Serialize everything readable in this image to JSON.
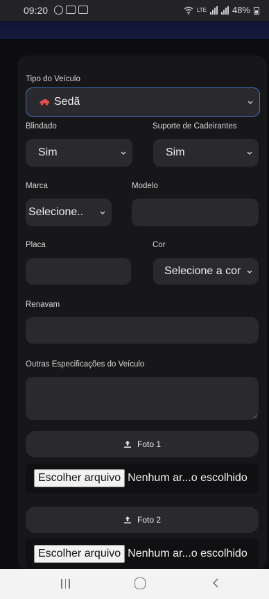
{
  "status_bar": {
    "time": "09:20",
    "network_text": "LTE",
    "battery": "48%"
  },
  "form": {
    "tipo_label": "Tipo do Veículo",
    "tipo_value": "Sedã",
    "blindado_label": "Blindado",
    "blindado_value": "Sim",
    "suporte_label": "Suporte de Cadeirantes",
    "suporte_value": "Sim",
    "marca_label": "Marca",
    "marca_value": "Selecione..",
    "modelo_label": "Modelo",
    "modelo_value": "",
    "placa_label": "Placa",
    "placa_value": "",
    "cor_label": "Cor",
    "cor_value": "Selecione a cor",
    "renavam_label": "Renavam",
    "renavam_value": "",
    "outras_label": "Outras Especificações do Veículo",
    "outras_value": ""
  },
  "photos": {
    "foto1_label": "Foto 1",
    "foto2_label": "Foto 2",
    "file_button": "Escolher arquivo",
    "file_status": "Nenhum ar...o escolhido"
  },
  "icons": {
    "vehicle": "car-icon",
    "dropdown": "chevron-down-icon",
    "upload": "upload-icon"
  },
  "colors": {
    "accent_focus": "#3f6fb8",
    "car_icon": "#e05050"
  }
}
